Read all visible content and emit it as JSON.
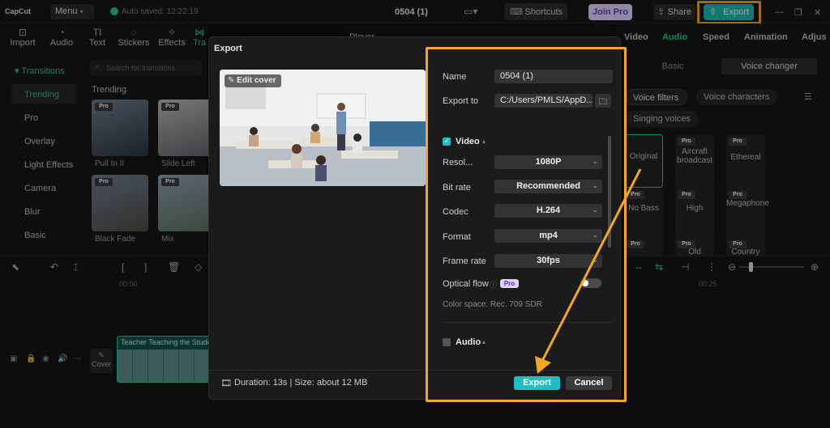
{
  "app": {
    "logo": "CapCut",
    "menu_label": "Menu",
    "autosave_text": "Auto saved: 12:22:19",
    "project_title": "0504 (1)",
    "shortcuts_label": "Shortcuts",
    "join_pro_label": "Join Pro",
    "share_label": "Share",
    "export_label": "Export"
  },
  "left_tools": [
    "Import",
    "Audio",
    "Text",
    "Stickers",
    "Effects",
    "Tra"
  ],
  "transitions": {
    "header": "Transitions",
    "search_placeholder": "Search for transitions",
    "categories": [
      "Trending",
      "Pro",
      "Overlay",
      "Light Effects",
      "Camera",
      "Blur",
      "Basic"
    ],
    "section_title": "Trending",
    "items": [
      {
        "label": "Pull In II",
        "badge": "Pro"
      },
      {
        "label": "Slide Left",
        "badge": "Pro"
      },
      {
        "label": "Black Fade",
        "badge": "Pro"
      },
      {
        "label": "Mix",
        "badge": "Pro"
      }
    ]
  },
  "player": {
    "header": "Player"
  },
  "right_panel": {
    "tabs": [
      "Video",
      "Audio",
      "Speed",
      "Animation",
      "Adjus"
    ],
    "segments": [
      "Basic",
      "Voice changer"
    ],
    "filter_chips": [
      "Voice filters",
      "Voice characters"
    ],
    "singing_chip": "Singing voices",
    "voices": [
      {
        "label": "Original",
        "badge": ""
      },
      {
        "label": "Aircraft broadcast",
        "badge": "Pro"
      },
      {
        "label": "Ethereal",
        "badge": "Pro"
      },
      {
        "label": "No Bass",
        "badge": "Pro"
      },
      {
        "label": "High",
        "badge": "Pro"
      },
      {
        "label": "Megaphone",
        "badge": "Pro"
      },
      {
        "label": "",
        "badge": "Pro"
      },
      {
        "label": "Old",
        "badge": "Pro"
      },
      {
        "label": "Country",
        "badge": "Pro"
      }
    ]
  },
  "timeline": {
    "ruler": [
      "00:00",
      "00:25"
    ],
    "clip_title": "Teacher Teaching the Students",
    "cover_label": "Cover"
  },
  "export_dialog": {
    "title": "Export",
    "edit_cover_label": "Edit cover",
    "name_label": "Name",
    "name_value": "0504 (1)",
    "export_to_label": "Export to",
    "export_to_value": "C:/Users/PMLS/AppD...",
    "video_section": "Video",
    "settings": [
      {
        "label": "Resol...",
        "value": "1080P"
      },
      {
        "label": "Bit rate",
        "value": "Recommended"
      },
      {
        "label": "Codec",
        "value": "H.264"
      },
      {
        "label": "Format",
        "value": "mp4"
      },
      {
        "label": "Frame rate",
        "value": "30fps"
      }
    ],
    "optical_flow_label": "Optical flow",
    "pro_badge": "Pro",
    "color_space": "Color space: Rec. 709 SDR",
    "audio_section": "Audio",
    "footer": "Duration: 13s | Size: about 12 MB",
    "export_button": "Export",
    "cancel_button": "Cancel"
  },
  "colors": {
    "accent": "#1fc6a1",
    "export_button": "#1fbfc1",
    "highlight": "#f5a623",
    "dialog_bg": "#1b1b1c"
  }
}
